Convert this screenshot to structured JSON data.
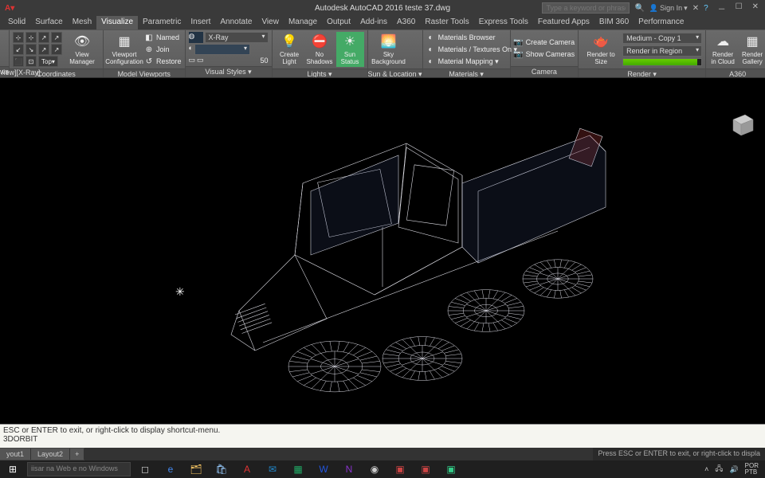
{
  "title_center": "Autodesk AutoCAD 2016   teste 37.dwg",
  "search_placeholder": "Type a keyword or phrase",
  "user_label": "Sign In",
  "tabs": [
    "Solid",
    "Surface",
    "Mesh",
    "Visualize",
    "Parametric",
    "Insert",
    "Annotate",
    "View",
    "Manage",
    "Output",
    "Add-ins",
    "A360",
    "Raster Tools",
    "Express Tools",
    "Featured Apps",
    "BIM 360",
    "Performance"
  ],
  "active_tab": 3,
  "view_label": "/iew][X-Ray]",
  "panels": {
    "p0ws": {
      "title": "ws"
    },
    "p0": {
      "title": "Coordinates",
      "big": "View Manager",
      "rows_a": [
        "",
        "",
        "",
        ""
      ],
      "rows_b": [
        "",
        "",
        "Top"
      ]
    },
    "p1": {
      "title": "Model Viewports",
      "big": "Viewport Configuration",
      "rows": [
        {
          "i": "◧",
          "t": "Named"
        },
        {
          "i": "⊕",
          "t": "Join"
        },
        {
          "i": "↺",
          "t": "Restore"
        }
      ]
    },
    "p2": {
      "title": "Visual Styles ▾",
      "dd": "X-Ray",
      "num": "50"
    },
    "p3": {
      "title": "Lights ▾",
      "items": [
        {
          "i": "💡",
          "t": "Create Light"
        },
        {
          "i": "⛔",
          "t": "No Shadows"
        },
        {
          "i": "☀",
          "t": "Sun Status",
          "hl": true
        }
      ]
    },
    "p4": {
      "title": "Sun & Location ▾",
      "big": "Sky Background"
    },
    "p5": {
      "title": "Materials ▾",
      "rows": [
        {
          "i": "◐",
          "t": "Materials Browser"
        },
        {
          "i": "◐",
          "t": "Materials / Textures On ▾"
        },
        {
          "i": "◐",
          "t": "Material Mapping ▾"
        }
      ]
    },
    "p6": {
      "title": "Camera",
      "rows": [
        {
          "i": "📷",
          "t": "Create Camera"
        },
        {
          "i": "📷",
          "t": "Show Cameras"
        }
      ]
    },
    "p7": {
      "title": "Render ▾",
      "big": "Render to Size",
      "dd1": "Medium - Copy 1",
      "dd2": "Render in Region"
    },
    "p8": {
      "title": "A360",
      "items": [
        {
          "i": "☁",
          "t": "Render in Cloud"
        },
        {
          "i": "▦",
          "t": "Render Gallery"
        }
      ]
    }
  },
  "cmd_line1": "ESC or ENTER to exit, or right-click to display shortcut-menu.",
  "cmd_line2": "3DORBIT",
  "layout_tabs": [
    "yout1",
    "Layout2",
    "+"
  ],
  "status_text": "Press ESC or ENTER to exit, or right-click to displa",
  "taskbar_search": "iisar na Web e no Windows",
  "tray_lang": "POR\nPTB"
}
